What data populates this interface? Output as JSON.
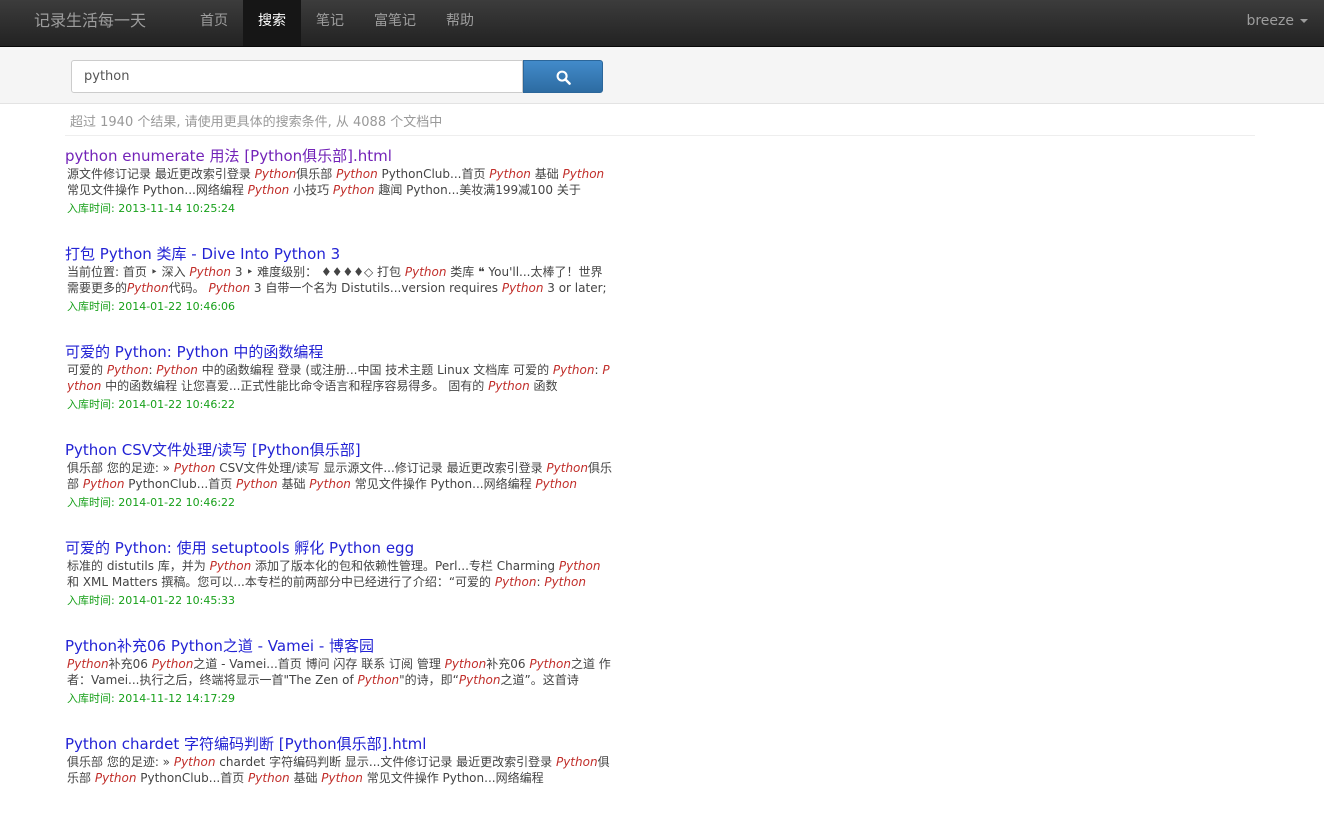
{
  "app": {
    "brand": "记录生活每一天"
  },
  "nav": {
    "items": [
      "首页",
      "搜索",
      "笔记",
      "富笔记",
      "帮助"
    ],
    "active": "搜索",
    "user": "breeze"
  },
  "search": {
    "value": "python",
    "placeholder": ""
  },
  "summary": "超过 1940 个结果, 请使用更具体的搜索条件, 从 4088 个文档中",
  "results": [
    {
      "title": "python enumerate 用法 [Python俱乐部].html",
      "visited": true,
      "snippet": "源文件修订记录 最近更改索引登录 <em>Python</em>俱乐部 <em>Python</em> PythonClub...首页 <em>Python</em> 基础 <em>Python</em> 常见文件操作 Python...网络编程 <em>Python</em> 小技巧 <em>Python</em> 趣闻 Python...美妆满199减100 关于",
      "date": "入库时间: 2013-11-14 10:25:24"
    },
    {
      "title": "打包 Python 类库 - Dive Into Python 3",
      "visited": false,
      "snippet": "当前位置: 首页 ‣ 深入 <em>Python</em> 3 ‣ 难度级别： ♦♦♦♦◇ 打包 <em>Python</em> 类库 ❝ You'll...太棒了！世界需要更多的<em>Python</em>代码。 <em>Python</em> 3 自带一个名为 Distutils...version requires <em>Python</em> 3 or later;",
      "date": "入库时间: 2014-01-22 10:46:06"
    },
    {
      "title": "可爱的 Python: Python 中的函数编程",
      "visited": false,
      "snippet": "可爱的 <em>Python</em>: <em>Python</em> 中的函数编程 登录 (或注册...中国 技术主题 Linux 文档库 可爱的 <em>Python</em>: <em>Python</em> 中的函数编程 让您喜爱...正式性能比命令语言和程序容易得多。 固有的 <em>Python</em> 函数",
      "date": "入库时间: 2014-01-22 10:46:22"
    },
    {
      "title": "Python CSV文件处理/读写 [Python俱乐部]",
      "visited": false,
      "snippet": "俱乐部 您的足迹: » <em>Python</em> CSV文件处理/读写 显示源文件...修订记录 最近更改索引登录 <em>Python</em>俱乐部 <em>Python</em> PythonClub...首页 <em>Python</em> 基础 <em>Python</em> 常见文件操作 Python...网络编程 <em>Python</em>",
      "date": "入库时间: 2014-01-22 10:46:22"
    },
    {
      "title": "可爱的 Python: 使用 setuptools 孵化 Python egg",
      "visited": false,
      "snippet": "标准的 distutils 库，并为 <em>Python</em> 添加了版本化的包和依赖性管理。Perl...专栏 Charming <em>Python</em> 和 XML Matters 撰稿。您可以...本专栏的前两部分中已经进行了介绍：“可爱的 <em>Python</em>: <em>Python</em>",
      "date": "入库时间: 2014-01-22 10:45:33"
    },
    {
      "title": "Python补充06 Python之道 - Vamei - 博客园",
      "visited": false,
      "snippet": "<em>Python</em>补充06 <em>Python</em>之道 - Vamei...首页 博问 闪存 联系 订阅 管理 <em>Python</em>补充06 <em>Python</em>之道 作者：Vamei...执行之后，终端将显示一首\"The Zen of <em>Python</em>\"的诗，即“<em>Python</em>之道”。这首诗",
      "date": "入库时间: 2014-11-12 14:17:29"
    },
    {
      "title": "Python chardet 字符编码判断 [Python俱乐部].html",
      "visited": false,
      "snippet": "俱乐部 您的足迹: » <em>Python</em> chardet 字符编码判断 显示...文件修订记录 最近更改索引登录 <em>Python</em>俱乐部 <em>Python</em> PythonClub...首页 <em>Python</em> 基础 <em>Python</em> 常见文件操作 Python...网络编程",
      "date": ""
    }
  ]
}
